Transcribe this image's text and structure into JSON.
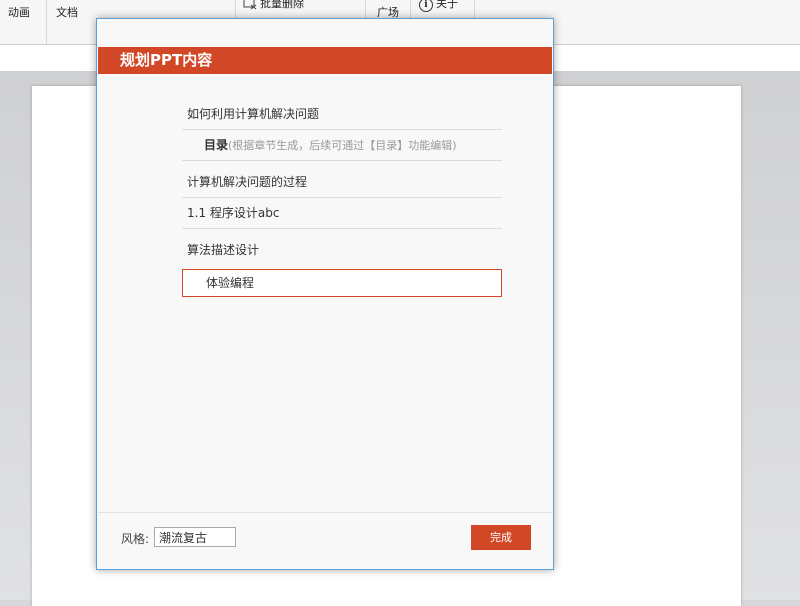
{
  "ribbon": {
    "animation_label": "动画",
    "new_doc_label": "文档",
    "batch_delete_label": "批量删除",
    "plaza_label": "广场",
    "about_label": "关于"
  },
  "dialog": {
    "title": "规划PPT内容",
    "outline": [
      {
        "text": "如何利用计算机解决问题"
      },
      {
        "bold": "目录",
        "hint": "(根据章节生成，后续可通过【目录】功能编辑)"
      },
      {
        "text": "计算机解决问题的过程"
      },
      {
        "text": "1.1 程序设计abc"
      },
      {
        "text": "算法描述设计"
      },
      {
        "text": "体验编程"
      }
    ],
    "style_label": "风格:",
    "style_value": "潮流复古",
    "done_label": "完成"
  },
  "colors": {
    "accent": "#d24726",
    "dialog_border": "#5aa0d6"
  }
}
